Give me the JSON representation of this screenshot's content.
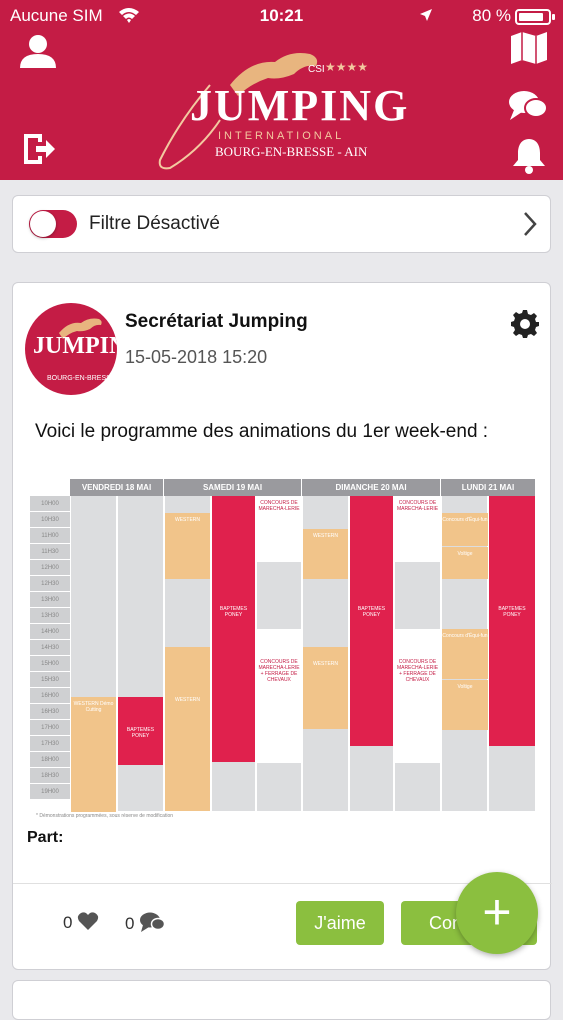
{
  "status_bar": {
    "carrier": "Aucune SIM",
    "time": "10:21",
    "battery": "80 %"
  },
  "header": {
    "logo": {
      "brand": "JUMPING",
      "subtitle": "INTERNATIONAL",
      "city": "BOURG-EN-BRESSE - AIN",
      "rating": "CSI",
      "stars": "★★★★"
    }
  },
  "filter": {
    "label": "Filtre Désactivé",
    "enabled": false
  },
  "post": {
    "author": "Secrétariat Jumping",
    "date": "15-05-2018 15:20",
    "text": "Voici le programme des animations du 1er week-end :",
    "avatar_city": "BOURG-EN-BRESSE",
    "schedule": {
      "days": [
        "VENDREDI 18 MAI",
        "SAMEDI 19 MAI",
        "DIMANCHE 20 MAI",
        "LUNDI 21 MAI"
      ],
      "hours": [
        "10H00",
        "10H30",
        "11H00",
        "11H30",
        "12H00",
        "12H30",
        "13H00",
        "13H30",
        "14H00",
        "14H30",
        "15H00",
        "15H30",
        "16H00",
        "16H30",
        "17H00",
        "17H30",
        "18H00",
        "18H30",
        "19H00"
      ],
      "events": {
        "bapteme": "BAPTEMES PONEY",
        "concours_mar": "CONCOURS DE MARECHA-LERIE",
        "concours_ferrage": "CONCOURS DE MARECHA-LERIE + FERRAGE DE CHEVAUX",
        "western": "WESTERN",
        "western_long": "WESTERN Démo Cutting",
        "voltige": "Voltige",
        "concours_poney": "Concours d'Équi-fun"
      },
      "note": "* Démonstrations programmées, sous réserve de modification"
    },
    "part_label": "Part:",
    "likes": "0",
    "comments": "0",
    "like_label": "J'aime",
    "comment_label": "Con"
  },
  "colors": {
    "brand": "#c41c45",
    "accent_green": "#8bbf3f"
  }
}
